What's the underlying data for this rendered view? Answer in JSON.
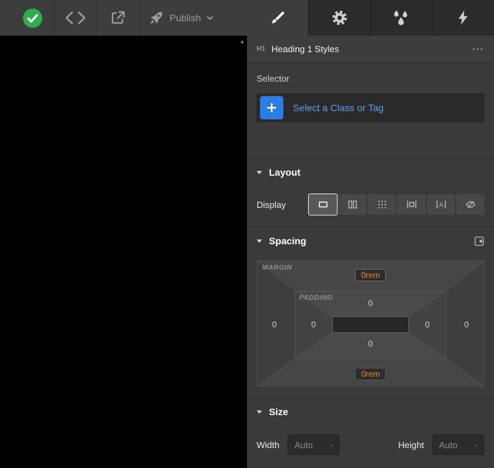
{
  "topbar": {
    "publish_label": "Publish"
  },
  "tabs": [
    {
      "id": "style",
      "icon": "paintbrush",
      "active": true
    },
    {
      "id": "settings",
      "icon": "gear",
      "active": false
    },
    {
      "id": "interactions",
      "icon": "water-drops",
      "active": false
    },
    {
      "id": "triggers",
      "icon": "lightning-bolt",
      "active": false
    }
  ],
  "canvas": {
    "scroll_up_glyph": "▲"
  },
  "panel": {
    "breadcrumb": {
      "tag": "H1",
      "title": "Heading 1 Styles",
      "menu_glyph": "···"
    },
    "selector": {
      "label": "Selector",
      "placeholder": "Select a Class or Tag"
    },
    "layout": {
      "title": "Layout",
      "display_label": "Display",
      "options": [
        "block",
        "flex",
        "grid",
        "inline-block",
        "inline",
        "none"
      ],
      "selected_option": "block"
    },
    "spacing": {
      "title": "Spacing",
      "margin_label": "MARGIN",
      "padding_label": "PADDING",
      "margin": {
        "top": "0rem",
        "right": "0",
        "bottom": "0rem",
        "left": "0"
      },
      "padding": {
        "top": "0",
        "right": "0",
        "bottom": "0",
        "left": "0"
      }
    },
    "size": {
      "title": "Size",
      "width_label": "Width",
      "width_value": "Auto",
      "width_unit": "-",
      "height_label": "Height",
      "height_value": "Auto",
      "height_unit": "-"
    }
  },
  "colors": {
    "accent_blue": "#2d7ce1",
    "link_blue": "#5f9df3",
    "value_orange": "#e5893b",
    "status_green": "#2eae4e"
  }
}
